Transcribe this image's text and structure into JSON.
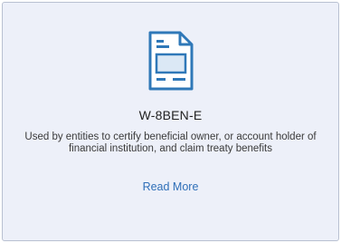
{
  "card": {
    "icon": "document-form-icon",
    "title": "W-8BEN-E",
    "description": "Used by entities to certify beneficial owner, or account holder of financial institution, and claim treaty benefits",
    "read_more_label": "Read More"
  },
  "colors": {
    "card_background": "#edf0f9",
    "card_border": "#b9c1d1",
    "icon_stroke": "#2f78b8",
    "link": "#2f6fb8"
  }
}
